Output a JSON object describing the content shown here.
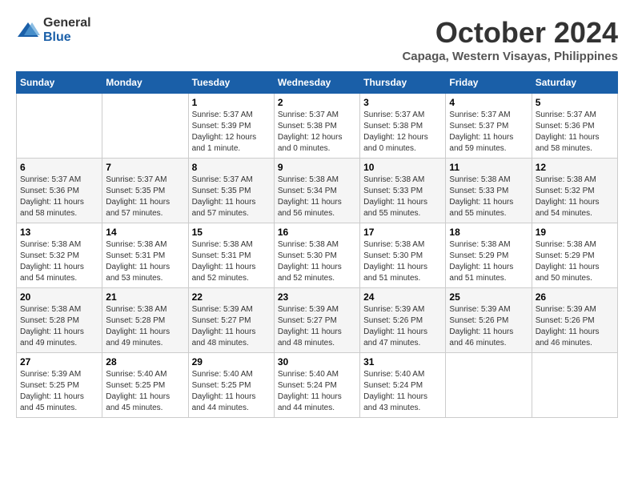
{
  "logo": {
    "text_general": "General",
    "text_blue": "Blue"
  },
  "header": {
    "month": "October 2024",
    "location": "Capaga, Western Visayas, Philippines"
  },
  "weekdays": [
    "Sunday",
    "Monday",
    "Tuesday",
    "Wednesday",
    "Thursday",
    "Friday",
    "Saturday"
  ],
  "weeks": [
    [
      {
        "day": "",
        "info": ""
      },
      {
        "day": "",
        "info": ""
      },
      {
        "day": "1",
        "info": "Sunrise: 5:37 AM\nSunset: 5:39 PM\nDaylight: 12 hours\nand 1 minute."
      },
      {
        "day": "2",
        "info": "Sunrise: 5:37 AM\nSunset: 5:38 PM\nDaylight: 12 hours\nand 0 minutes."
      },
      {
        "day": "3",
        "info": "Sunrise: 5:37 AM\nSunset: 5:38 PM\nDaylight: 12 hours\nand 0 minutes."
      },
      {
        "day": "4",
        "info": "Sunrise: 5:37 AM\nSunset: 5:37 PM\nDaylight: 11 hours\nand 59 minutes."
      },
      {
        "day": "5",
        "info": "Sunrise: 5:37 AM\nSunset: 5:36 PM\nDaylight: 11 hours\nand 58 minutes."
      }
    ],
    [
      {
        "day": "6",
        "info": "Sunrise: 5:37 AM\nSunset: 5:36 PM\nDaylight: 11 hours\nand 58 minutes."
      },
      {
        "day": "7",
        "info": "Sunrise: 5:37 AM\nSunset: 5:35 PM\nDaylight: 11 hours\nand 57 minutes."
      },
      {
        "day": "8",
        "info": "Sunrise: 5:37 AM\nSunset: 5:35 PM\nDaylight: 11 hours\nand 57 minutes."
      },
      {
        "day": "9",
        "info": "Sunrise: 5:38 AM\nSunset: 5:34 PM\nDaylight: 11 hours\nand 56 minutes."
      },
      {
        "day": "10",
        "info": "Sunrise: 5:38 AM\nSunset: 5:33 PM\nDaylight: 11 hours\nand 55 minutes."
      },
      {
        "day": "11",
        "info": "Sunrise: 5:38 AM\nSunset: 5:33 PM\nDaylight: 11 hours\nand 55 minutes."
      },
      {
        "day": "12",
        "info": "Sunrise: 5:38 AM\nSunset: 5:32 PM\nDaylight: 11 hours\nand 54 minutes."
      }
    ],
    [
      {
        "day": "13",
        "info": "Sunrise: 5:38 AM\nSunset: 5:32 PM\nDaylight: 11 hours\nand 54 minutes."
      },
      {
        "day": "14",
        "info": "Sunrise: 5:38 AM\nSunset: 5:31 PM\nDaylight: 11 hours\nand 53 minutes."
      },
      {
        "day": "15",
        "info": "Sunrise: 5:38 AM\nSunset: 5:31 PM\nDaylight: 11 hours\nand 52 minutes."
      },
      {
        "day": "16",
        "info": "Sunrise: 5:38 AM\nSunset: 5:30 PM\nDaylight: 11 hours\nand 52 minutes."
      },
      {
        "day": "17",
        "info": "Sunrise: 5:38 AM\nSunset: 5:30 PM\nDaylight: 11 hours\nand 51 minutes."
      },
      {
        "day": "18",
        "info": "Sunrise: 5:38 AM\nSunset: 5:29 PM\nDaylight: 11 hours\nand 51 minutes."
      },
      {
        "day": "19",
        "info": "Sunrise: 5:38 AM\nSunset: 5:29 PM\nDaylight: 11 hours\nand 50 minutes."
      }
    ],
    [
      {
        "day": "20",
        "info": "Sunrise: 5:38 AM\nSunset: 5:28 PM\nDaylight: 11 hours\nand 49 minutes."
      },
      {
        "day": "21",
        "info": "Sunrise: 5:38 AM\nSunset: 5:28 PM\nDaylight: 11 hours\nand 49 minutes."
      },
      {
        "day": "22",
        "info": "Sunrise: 5:39 AM\nSunset: 5:27 PM\nDaylight: 11 hours\nand 48 minutes."
      },
      {
        "day": "23",
        "info": "Sunrise: 5:39 AM\nSunset: 5:27 PM\nDaylight: 11 hours\nand 48 minutes."
      },
      {
        "day": "24",
        "info": "Sunrise: 5:39 AM\nSunset: 5:26 PM\nDaylight: 11 hours\nand 47 minutes."
      },
      {
        "day": "25",
        "info": "Sunrise: 5:39 AM\nSunset: 5:26 PM\nDaylight: 11 hours\nand 46 minutes."
      },
      {
        "day": "26",
        "info": "Sunrise: 5:39 AM\nSunset: 5:26 PM\nDaylight: 11 hours\nand 46 minutes."
      }
    ],
    [
      {
        "day": "27",
        "info": "Sunrise: 5:39 AM\nSunset: 5:25 PM\nDaylight: 11 hours\nand 45 minutes."
      },
      {
        "day": "28",
        "info": "Sunrise: 5:40 AM\nSunset: 5:25 PM\nDaylight: 11 hours\nand 45 minutes."
      },
      {
        "day": "29",
        "info": "Sunrise: 5:40 AM\nSunset: 5:25 PM\nDaylight: 11 hours\nand 44 minutes."
      },
      {
        "day": "30",
        "info": "Sunrise: 5:40 AM\nSunset: 5:24 PM\nDaylight: 11 hours\nand 44 minutes."
      },
      {
        "day": "31",
        "info": "Sunrise: 5:40 AM\nSunset: 5:24 PM\nDaylight: 11 hours\nand 43 minutes."
      },
      {
        "day": "",
        "info": ""
      },
      {
        "day": "",
        "info": ""
      }
    ]
  ]
}
